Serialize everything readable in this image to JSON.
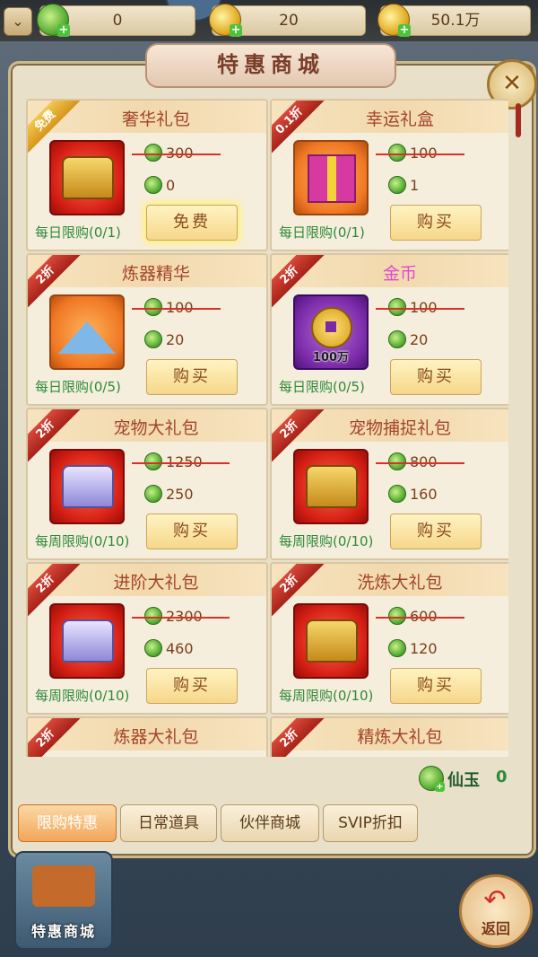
{
  "resources": [
    {
      "icon": "jade-plus-icon",
      "value": "0"
    },
    {
      "icon": "gold-ingot-plus-icon",
      "value": "20"
    },
    {
      "icon": "coin-plus-icon",
      "value": "50.1万"
    }
  ],
  "shop_title": "特惠商城",
  "items": [
    {
      "badge": "免费",
      "name": "奢华礼包",
      "name_color": "#a3452a",
      "old_price": "300",
      "new_price": "0",
      "limit": "每日限购(0/1)",
      "button": "免费",
      "icon": "golden-chest-icon"
    },
    {
      "badge": "0.1折",
      "name": "幸运礼盒",
      "name_color": "#a3452a",
      "old_price": "100",
      "new_price": "1",
      "limit": "每日限购(0/1)",
      "button": "购买",
      "icon": "gift-box-icon"
    },
    {
      "badge": "2折",
      "name": "炼器精华",
      "name_color": "#a3452a",
      "old_price": "100",
      "new_price": "20",
      "limit": "每日限购(0/5)",
      "button": "购买",
      "icon": "crystal-pile-icon"
    },
    {
      "badge": "2折",
      "name": "金币",
      "name_color": "#e04ad0",
      "old_price": "100",
      "new_price": "20",
      "limit": "每日限购(0/5)",
      "button": "购买",
      "icon": "gold-coin-icon",
      "icon_label": "100万"
    },
    {
      "badge": "2折",
      "name": "宠物大礼包",
      "name_color": "#a3452a",
      "old_price": "1250",
      "new_price": "250",
      "limit": "每周限购(0/10)",
      "button": "购买",
      "icon": "silver-chest-icon"
    },
    {
      "badge": "2折",
      "name": "宠物捕捉礼包",
      "name_color": "#a3452a",
      "old_price": "800",
      "new_price": "160",
      "limit": "每周限购(0/10)",
      "button": "购买",
      "icon": "golden-chest-icon"
    },
    {
      "badge": "2折",
      "name": "进阶大礼包",
      "name_color": "#a3452a",
      "old_price": "2300",
      "new_price": "460",
      "limit": "每周限购(0/10)",
      "button": "购买",
      "icon": "silver-chest-icon"
    },
    {
      "badge": "2折",
      "name": "洗炼大礼包",
      "name_color": "#a3452a",
      "old_price": "600",
      "new_price": "120",
      "limit": "每周限购(0/10)",
      "button": "购买",
      "icon": "golden-chest-icon"
    },
    {
      "badge": "2折",
      "name": "炼器大礼包",
      "name_color": "#a3452a"
    },
    {
      "badge": "2折",
      "name": "精炼大礼包",
      "name_color": "#a3452a"
    }
  ],
  "jade_balance": {
    "label": "仙玉",
    "value": "0"
  },
  "tabs": [
    "限购特惠",
    "日常道具",
    "伙伴商城",
    "SVIP折扣"
  ],
  "active_tab": 0,
  "bottom_left_label": "特惠商城",
  "back_label": "返回",
  "close_glyph": "✕"
}
